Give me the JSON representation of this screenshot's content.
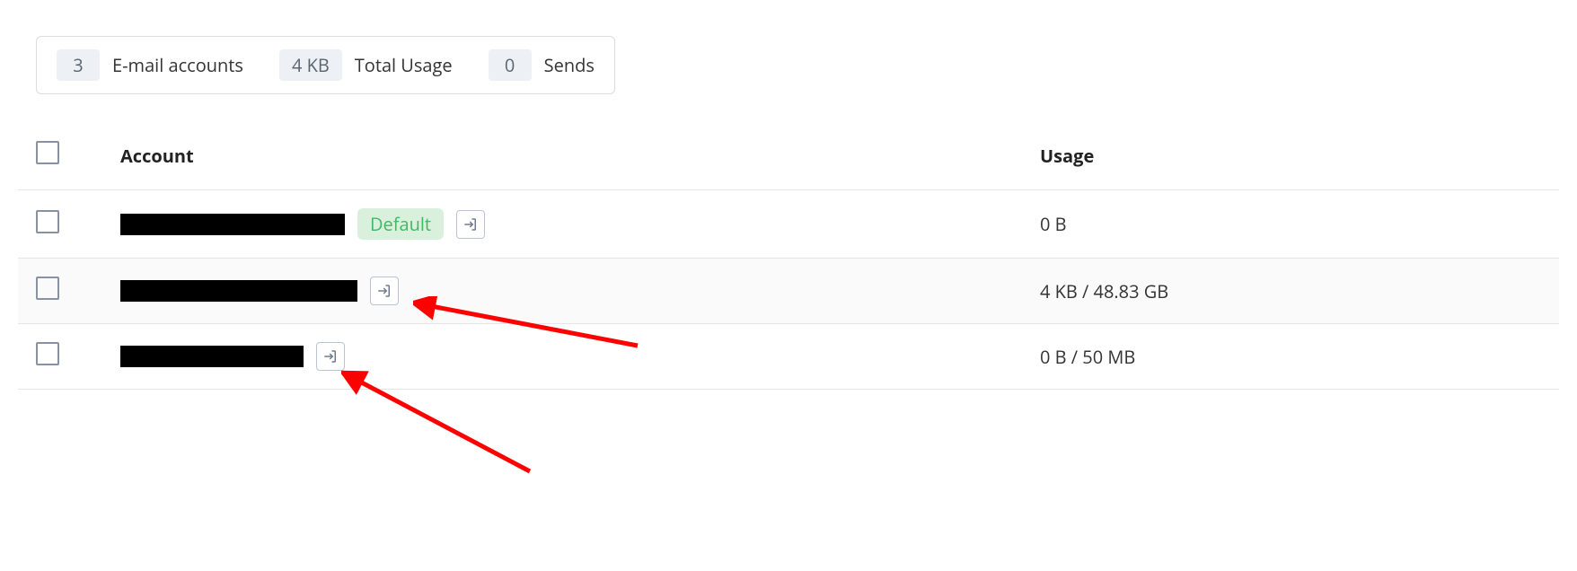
{
  "stats": {
    "accounts_count": "3",
    "accounts_label": "E-mail accounts",
    "total_usage_value": "4 KB",
    "total_usage_label": "Total Usage",
    "sends_value": "0",
    "sends_label": "Sends"
  },
  "table": {
    "headers": {
      "account": "Account",
      "usage": "Usage"
    },
    "rows": [
      {
        "default_badge": "Default",
        "usage": "0 B"
      },
      {
        "usage": "4 KB / 48.83 GB"
      },
      {
        "usage": "0 B / 50 MB"
      }
    ]
  }
}
